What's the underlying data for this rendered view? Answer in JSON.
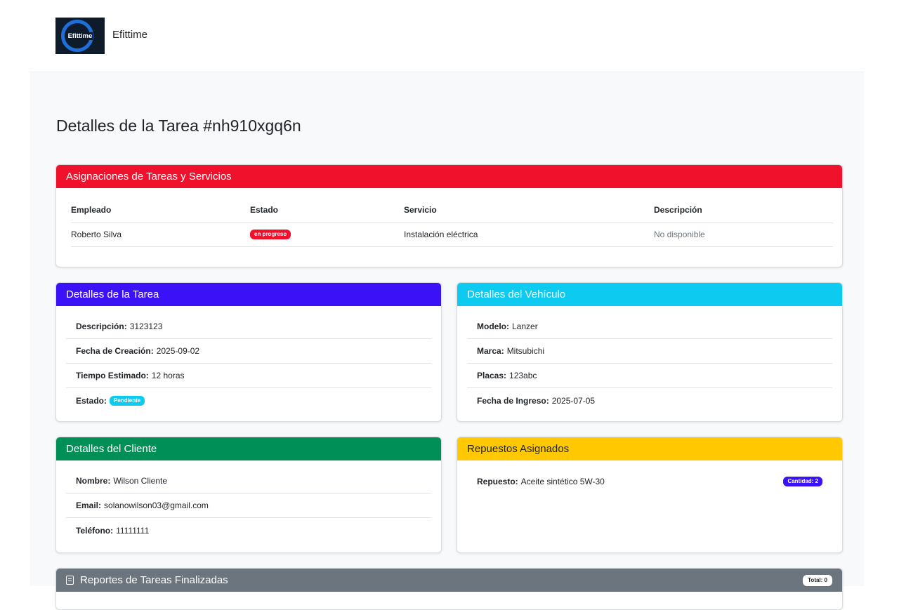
{
  "brand": {
    "logo_text": "Efittime",
    "name": "Efittime"
  },
  "page_title": "Detalles de la Tarea #nh910xgq6n",
  "assignments": {
    "title": "Asignaciones de Tareas y Servicios",
    "columns": [
      "Empleado",
      "Estado",
      "Servicio",
      "Descripción"
    ],
    "rows": [
      {
        "employee": "Roberto Silva",
        "status": "en progreso",
        "service": "Instalación eléctrica",
        "description": "No disponible"
      }
    ]
  },
  "task_details": {
    "title": "Detalles de la Tarea",
    "description_label": "Descripción:",
    "description": "3123123",
    "created_label": "Fecha de Creación:",
    "created": "2025-09-02",
    "estimate_label": "Tiempo Estimado:",
    "estimate": "12 horas",
    "status_label": "Estado:",
    "status": "Pendiente"
  },
  "vehicle": {
    "title": "Detalles del Vehículo",
    "model_label": "Modelo:",
    "model": "Lanzer",
    "brand_label": "Marca:",
    "brand": "Mitsubichi",
    "plates_label": "Placas:",
    "plates": "123abc",
    "entry_label": "Fecha de Ingreso:",
    "entry": "2025-07-05"
  },
  "client": {
    "title": "Detalles del Cliente",
    "name_label": "Nombre:",
    "name": "Wilson Cliente",
    "email_label": "Email:",
    "email": "solanowilson03@gmail.com",
    "phone_label": "Teléfono:",
    "phone": "11111111"
  },
  "parts": {
    "title": "Repuestos Asignados",
    "items": [
      {
        "label": "Repuesto:",
        "name": "Aceite sintético 5W-30",
        "qty": "Cantidad: 2"
      }
    ]
  },
  "reports": {
    "title": "Reportes de Tareas Finalizadas",
    "total": "Total: 0",
    "icon": "journal-text-icon"
  },
  "colors": {
    "red": "#f0112d",
    "indigo": "#3b11f7",
    "cyan": "#0dcaf0",
    "green": "#008f57",
    "yellow": "#ffc800",
    "gray": "#6c757d"
  }
}
